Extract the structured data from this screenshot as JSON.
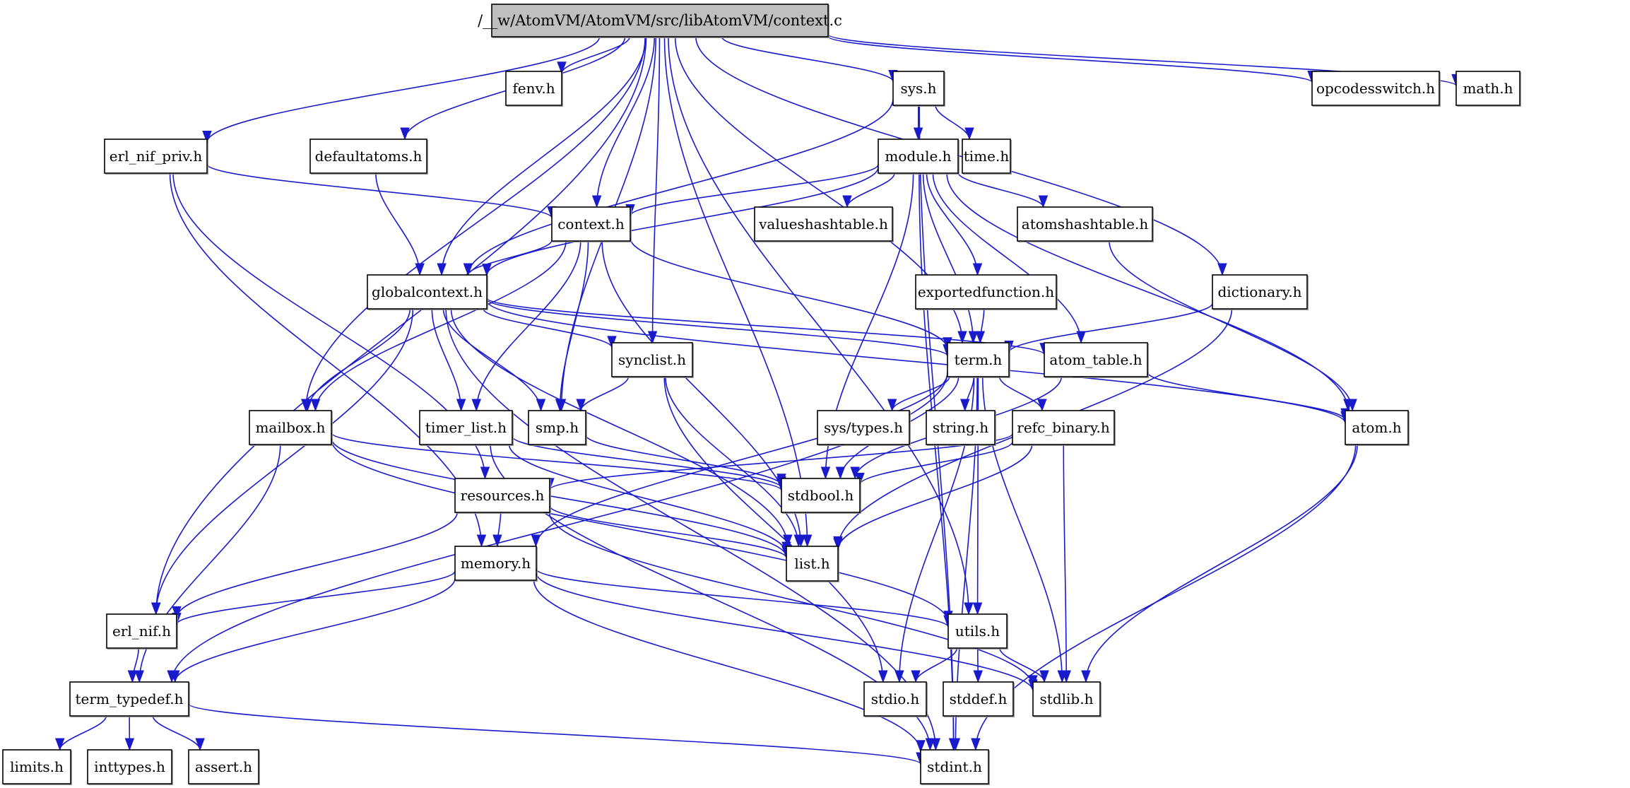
{
  "diagram": {
    "type": "include-dependency-graph",
    "root": "root",
    "colors": {
      "edge": "#1a1acd",
      "root_fill": "#bfbfbf",
      "node_fill": "#ffffff",
      "node_border": "#000000"
    },
    "nodes": {
      "root": "/__w/AtomVM/AtomVM/src/libAtomVM/context.c",
      "fenv": "fenv.h",
      "sys": "sys.h",
      "opcodesswitch": "opcodesswitch.h",
      "math": "math.h",
      "erl_nif_priv": "erl_nif_priv.h",
      "defaultatoms": "defaultatoms.h",
      "module": "module.h",
      "time": "time.h",
      "context": "context.h",
      "valueshashtable": "valueshashtable.h",
      "atomshashtable": "atomshashtable.h",
      "globalcontext": "globalcontext.h",
      "exportedfunction": "exportedfunction.h",
      "dictionary": "dictionary.h",
      "synclist": "synclist.h",
      "term": "term.h",
      "atom_table": "atom_table.h",
      "mailbox": "mailbox.h",
      "timer_list": "timer_list.h",
      "smp": "smp.h",
      "sys_types": "sys/types.h",
      "string": "string.h",
      "refc_binary": "refc_binary.h",
      "atom": "atom.h",
      "resources": "resources.h",
      "stdbool": "stdbool.h",
      "memory": "memory.h",
      "list": "list.h",
      "erl_nif": "erl_nif.h",
      "utils": "utils.h",
      "term_typedef": "term_typedef.h",
      "stdio": "stdio.h",
      "stddef": "stddef.h",
      "stdlib": "stdlib.h",
      "limits": "limits.h",
      "inttypes": "inttypes.h",
      "assert": "assert.h",
      "stdint": "stdint.h"
    },
    "edges": [
      [
        "root",
        "erl_nif"
      ],
      [
        "root",
        "erl_nif_priv"
      ],
      [
        "root",
        "mailbox"
      ],
      [
        "root",
        "defaultatoms"
      ],
      [
        "root",
        "globalcontext"
      ],
      [
        "root",
        "fenv"
      ],
      [
        "root",
        "context"
      ],
      [
        "root",
        "smp"
      ],
      [
        "root",
        "synclist"
      ],
      [
        "root",
        "sys"
      ],
      [
        "root",
        "term"
      ],
      [
        "root",
        "dictionary"
      ],
      [
        "root",
        "list"
      ],
      [
        "root",
        "opcodesswitch"
      ],
      [
        "root",
        "math"
      ],
      [
        "root",
        "utils"
      ],
      [
        "sys",
        "module"
      ],
      [
        "sys",
        "time"
      ],
      [
        "sys",
        "globalcontext"
      ],
      [
        "sys",
        "stdint"
      ],
      [
        "module",
        "context"
      ],
      [
        "module",
        "globalcontext"
      ],
      [
        "module",
        "valueshashtable"
      ],
      [
        "module",
        "atomshashtable"
      ],
      [
        "module",
        "exportedfunction"
      ],
      [
        "module",
        "term"
      ],
      [
        "module",
        "atom_table"
      ],
      [
        "module",
        "atom"
      ],
      [
        "module",
        "stdbool"
      ],
      [
        "module",
        "stdint"
      ],
      [
        "erl_nif_priv",
        "context"
      ],
      [
        "erl_nif_priv",
        "memory"
      ],
      [
        "erl_nif_priv",
        "resources"
      ],
      [
        "defaultatoms",
        "globalcontext"
      ],
      [
        "context",
        "globalcontext"
      ],
      [
        "context",
        "mailbox"
      ],
      [
        "context",
        "timer_list"
      ],
      [
        "context",
        "smp"
      ],
      [
        "context",
        "list"
      ],
      [
        "context",
        "term"
      ],
      [
        "globalcontext",
        "erl_nif"
      ],
      [
        "globalcontext",
        "mailbox"
      ],
      [
        "globalcontext",
        "timer_list"
      ],
      [
        "globalcontext",
        "smp"
      ],
      [
        "globalcontext",
        "synclist"
      ],
      [
        "globalcontext",
        "term"
      ],
      [
        "globalcontext",
        "atom_table"
      ],
      [
        "globalcontext",
        "atom"
      ],
      [
        "globalcontext",
        "list"
      ],
      [
        "globalcontext",
        "stdint"
      ],
      [
        "atomshashtable",
        "atom"
      ],
      [
        "exportedfunction",
        "term"
      ],
      [
        "dictionary",
        "term"
      ],
      [
        "dictionary",
        "list"
      ],
      [
        "synclist",
        "smp"
      ],
      [
        "synclist",
        "list"
      ],
      [
        "synclist",
        "stdio"
      ],
      [
        "term",
        "term_typedef"
      ],
      [
        "term",
        "memory"
      ],
      [
        "term",
        "stdbool"
      ],
      [
        "term",
        "sys_types"
      ],
      [
        "term",
        "string"
      ],
      [
        "term",
        "refc_binary"
      ],
      [
        "term",
        "utils"
      ],
      [
        "term",
        "stdlib"
      ],
      [
        "term",
        "stdio"
      ],
      [
        "term",
        "stdint"
      ],
      [
        "atom_table",
        "atom"
      ],
      [
        "atom_table",
        "stdbool"
      ],
      [
        "atom",
        "stdlib"
      ],
      [
        "atom",
        "stdint"
      ],
      [
        "mailbox",
        "term_typedef"
      ],
      [
        "mailbox",
        "list"
      ],
      [
        "mailbox",
        "stdbool"
      ],
      [
        "mailbox",
        "utils"
      ],
      [
        "timer_list",
        "stdbool"
      ],
      [
        "timer_list",
        "list"
      ],
      [
        "timer_list",
        "stdint"
      ],
      [
        "smp",
        "stdbool"
      ],
      [
        "resources",
        "memory"
      ],
      [
        "resources",
        "erl_nif"
      ],
      [
        "resources",
        "list"
      ],
      [
        "resources",
        "stdlib"
      ],
      [
        "refc_binary",
        "resources"
      ],
      [
        "refc_binary",
        "stdbool"
      ],
      [
        "refc_binary",
        "list"
      ],
      [
        "refc_binary",
        "stdlib"
      ],
      [
        "memory",
        "erl_nif"
      ],
      [
        "memory",
        "term_typedef"
      ],
      [
        "memory",
        "utils"
      ],
      [
        "memory",
        "stdlib"
      ],
      [
        "memory",
        "stdint"
      ],
      [
        "erl_nif",
        "term_typedef"
      ],
      [
        "utils",
        "stdio"
      ],
      [
        "utils",
        "stddef"
      ],
      [
        "utils",
        "stdlib"
      ],
      [
        "term_typedef",
        "limits"
      ],
      [
        "term_typedef",
        "inttypes"
      ],
      [
        "term_typedef",
        "assert"
      ],
      [
        "term_typedef",
        "stdint"
      ]
    ]
  }
}
